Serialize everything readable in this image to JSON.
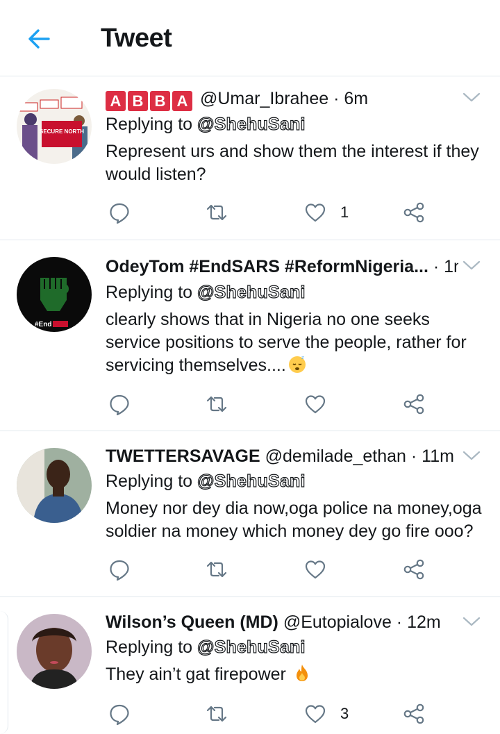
{
  "header": {
    "title": "Tweet",
    "back_icon": "arrow-left-icon",
    "accent": "#1da1f2"
  },
  "tweets": [
    {
      "name_badges": [
        "A",
        "B",
        "B",
        "A"
      ],
      "name": "",
      "handle": "@Umar_Ibrahee",
      "time": "6m",
      "replying_prefix": "Replying to",
      "replying_to": "@ShehuSani",
      "text": "Represent urs and show them the interest if they would listen?",
      "likes": "1",
      "avatar_text": "SECURE NORTH"
    },
    {
      "name": "OdeyTom #EndSARS #ReformNigeria...",
      "handle": "",
      "time": "1m",
      "replying_prefix": "Replying to",
      "replying_to": "@ShehuSani",
      "text": "clearly shows that in Nigeria no one seeks service positions to serve the people, rather for servicing themselves....",
      "text_emoji": "sleeping-face",
      "likes": "",
      "avatar_text": "#End"
    },
    {
      "name": "TWETTERSAVAGE",
      "handle": "@demilade_ethan",
      "time": "11m",
      "replying_prefix": "Replying to",
      "replying_to": "@ShehuSani",
      "text": "Money nor dey dia now,oga police na money,oga soldier na money which money dey go fire ooo?",
      "likes": ""
    },
    {
      "name": "Wilson’s Queen (MD)",
      "handle": "@Eutopialove",
      "time": "12m",
      "replying_prefix": "Replying to",
      "replying_to": "@ShehuSani",
      "text": "They ain’t gat firepower",
      "text_emoji": "fire",
      "likes": "3"
    }
  ],
  "colors": {
    "border": "#e1e8ed",
    "icon": "#657786",
    "text": "#14171a",
    "badge_red": "#dd2e44"
  }
}
